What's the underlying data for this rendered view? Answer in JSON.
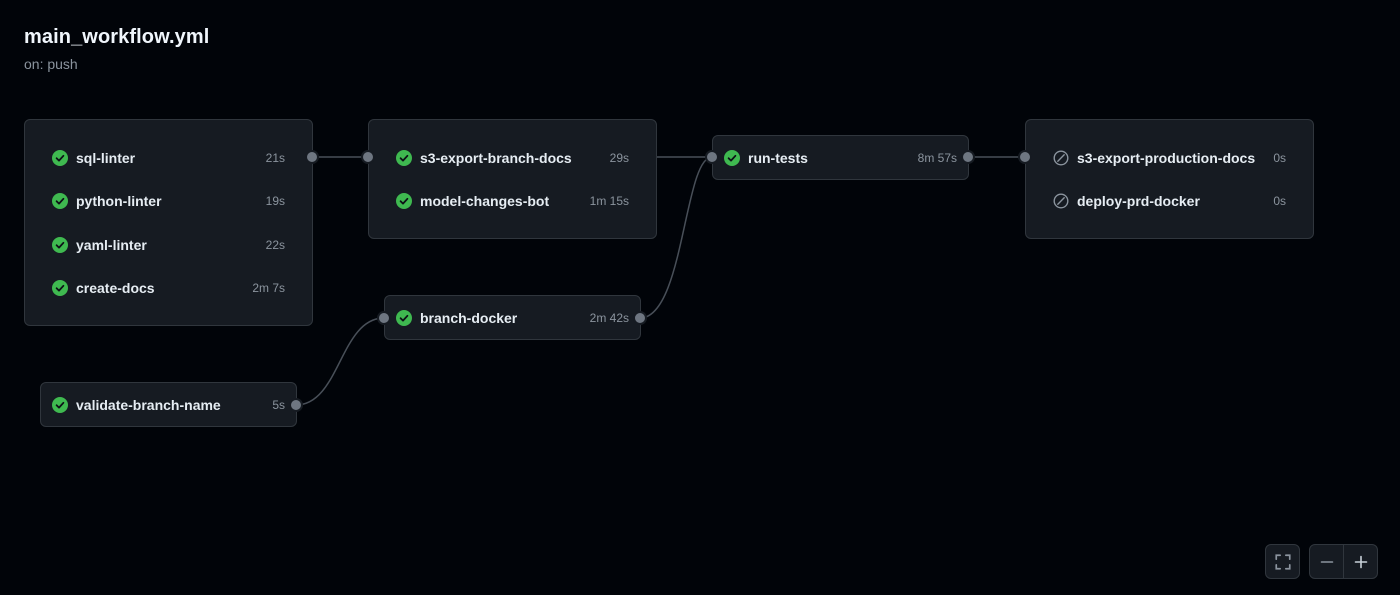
{
  "workflow": {
    "title": "main_workflow.yml",
    "trigger": "on: push"
  },
  "stages": [
    {
      "jobs": [
        {
          "name": "sql-linter",
          "duration": "21s",
          "status": "success"
        },
        {
          "name": "python-linter",
          "duration": "19s",
          "status": "success"
        },
        {
          "name": "yaml-linter",
          "duration": "22s",
          "status": "success"
        },
        {
          "name": "create-docs",
          "duration": "2m 7s",
          "status": "success"
        }
      ]
    },
    {
      "jobs": [
        {
          "name": "validate-branch-name",
          "duration": "5s",
          "status": "success"
        }
      ]
    },
    {
      "jobs": [
        {
          "name": "s3-export-branch-docs",
          "duration": "29s",
          "status": "success"
        },
        {
          "name": "model-changes-bot",
          "duration": "1m 15s",
          "status": "success"
        }
      ]
    },
    {
      "jobs": [
        {
          "name": "branch-docker",
          "duration": "2m 42s",
          "status": "success"
        }
      ]
    },
    {
      "jobs": [
        {
          "name": "run-tests",
          "duration": "8m 57s",
          "status": "success"
        }
      ]
    },
    {
      "jobs": [
        {
          "name": "s3-export-production-docs",
          "duration": "0s",
          "status": "skipped"
        },
        {
          "name": "deploy-prd-docker",
          "duration": "0s",
          "status": "skipped"
        }
      ]
    }
  ],
  "icons": {
    "success": "check-circle-fill-icon",
    "skipped": "skip-icon",
    "fullscreen": "fullscreen-icon",
    "zoom_out": "zoom-out-icon",
    "zoom_in": "zoom-in-icon"
  },
  "colors": {
    "background": "#010409",
    "card": "#161b22",
    "border": "#30363d",
    "success": "#3fb950",
    "muted": "#8b949e",
    "edge": "#484f58"
  }
}
